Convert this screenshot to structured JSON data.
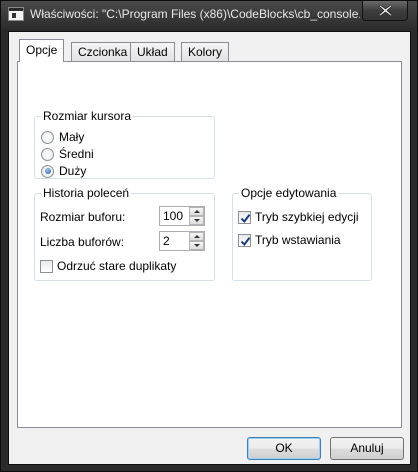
{
  "window": {
    "title": "Właściwości: \"C:\\Program Files (x86)\\CodeBlocks\\cb_console...",
    "app_icon": "console-window-icon",
    "close_icon": "close-x-icon"
  },
  "tabs": [
    {
      "label": "Opcje",
      "active": true
    },
    {
      "label": "Czcionka",
      "active": false
    },
    {
      "label": "Układ",
      "active": false
    },
    {
      "label": "Kolory",
      "active": false
    }
  ],
  "cursor_size": {
    "title": "Rozmiar kursora",
    "options": [
      {
        "label": "Mały",
        "checked": false
      },
      {
        "label": "Średni",
        "checked": false
      },
      {
        "label": "Duży",
        "checked": true
      }
    ]
  },
  "history": {
    "title": "Historia poleceń",
    "buffer_size_label": "Rozmiar buforu:",
    "buffer_size_value": "100",
    "buffer_count_label": "Liczba buforów:",
    "buffer_count_value": "2",
    "discard_duplicates_label": "Odrzuć stare duplikaty",
    "discard_duplicates_checked": false
  },
  "edit_options": {
    "title": "Opcje edytowania",
    "quick_edit_label": "Tryb szybkiej edycji",
    "quick_edit_checked": true,
    "insert_mode_label": "Tryb wstawiania",
    "insert_mode_checked": true
  },
  "buttons": {
    "ok": "OK",
    "cancel": "Anuluj"
  }
}
